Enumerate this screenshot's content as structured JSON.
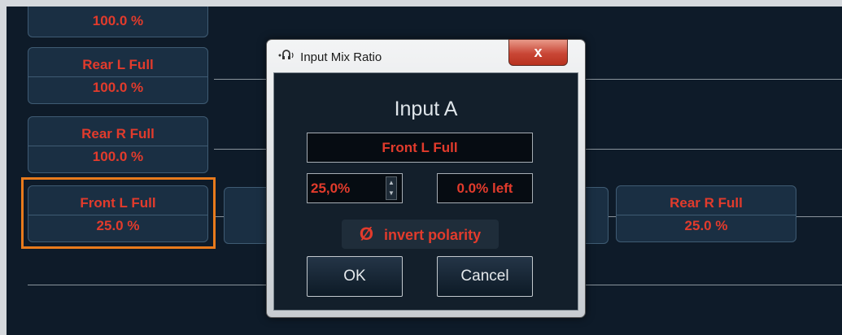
{
  "background_boxes": {
    "top_partial": {
      "percent": "100.0 %"
    },
    "rear_l": {
      "name": "Rear L Full",
      "percent": "100.0 %"
    },
    "rear_r": {
      "name": "Rear R Full",
      "percent": "100.0 %"
    },
    "front_l": {
      "name": "Front L Full",
      "percent": "25.0 %"
    },
    "rear_r_right": {
      "name": "Rear R Full",
      "percent": "25.0 %"
    }
  },
  "dialog": {
    "title": "Input Mix Ratio",
    "close_label": "x",
    "heading": "Input A",
    "source_value": "Front L Full",
    "ratio_value": "25,0%",
    "remaining_value": "0.0% left",
    "invert_symbol": "Ø",
    "invert_label": "invert polarity",
    "ok_label": "OK",
    "cancel_label": "Cancel"
  },
  "colors": {
    "accent_text": "#e23b2c",
    "selection_border": "#e87a1c",
    "background": "#0e1b29"
  }
}
